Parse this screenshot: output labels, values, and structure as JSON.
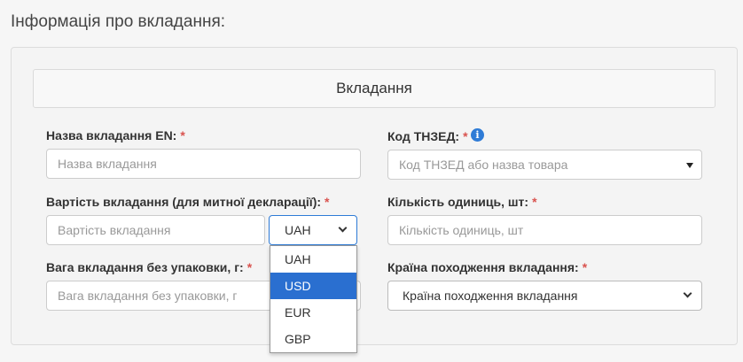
{
  "page_title": "Інформація про вкладання:",
  "section_title": "Вкладання",
  "fields": {
    "name_en": {
      "label": "Назва вкладання EN:",
      "required": "*",
      "placeholder": "Назва вкладання"
    },
    "hs_code": {
      "label": "Код ТНЗЕД:",
      "required": "*",
      "placeholder": "Код ТНЗЕД або назва товара",
      "info_icon": "i"
    },
    "value": {
      "label": "Вартість вкладання (для митної декларації):",
      "required": "*",
      "placeholder": "Вартість вкладання"
    },
    "currency": {
      "selected": "UAH",
      "options": [
        "UAH",
        "USD",
        "EUR",
        "GBP"
      ],
      "highlighted": "USD"
    },
    "quantity": {
      "label": "Кількість одиниць, шт:",
      "required": "*",
      "placeholder": "Кількість одиниць, шт"
    },
    "weight": {
      "label": "Вага вкладання без упаковки, г:",
      "required": "*",
      "placeholder": "Вага вкладання без упаковки, г"
    },
    "origin": {
      "label": "Країна походження вкладання:",
      "required": "*",
      "selected": "Країна походження вкладання"
    }
  },
  "colors": {
    "required": "#d9534f",
    "info": "#2e7bd6",
    "highlight": "#2a6fd0"
  }
}
